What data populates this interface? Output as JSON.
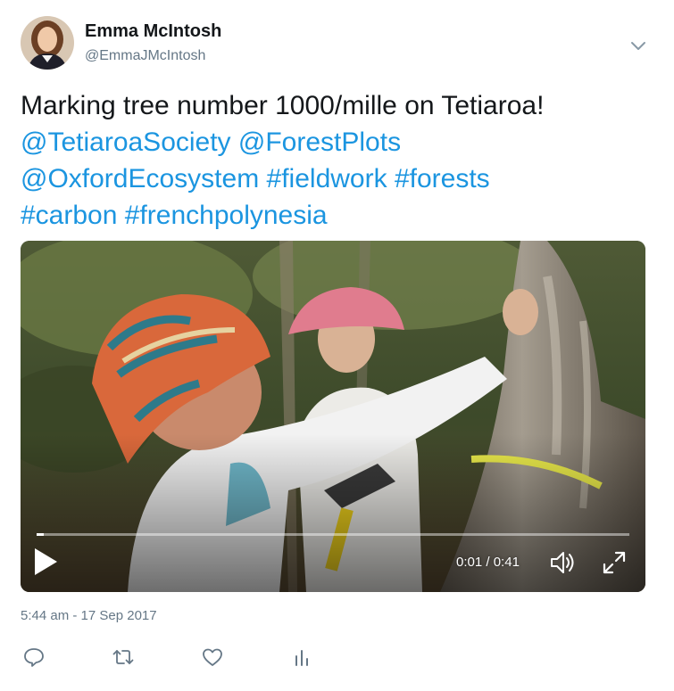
{
  "author": {
    "display_name": "Emma McIntosh",
    "handle": "@EmmaJMcIntosh"
  },
  "tweet": {
    "text_prefix": "Marking tree number 1000/mille on Tetiaroa! ",
    "mentions": [
      "@TetiaroaSociety",
      "@ForestPlots",
      "@OxfordEcosystem"
    ],
    "hashtags": [
      "#fieldwork",
      "#forests",
      "#carbon",
      "#frenchpolynesia"
    ],
    "link_color": "#1b95e0"
  },
  "video": {
    "current_time": "0:01",
    "separator": " / ",
    "duration": "0:41",
    "progress_fraction": 0.012
  },
  "timestamp": "5:44 am - 17 Sep 2017",
  "icons": {
    "caret": "chevron-down-icon",
    "reply": "reply-icon",
    "retweet": "retweet-icon",
    "like": "heart-icon",
    "analytics": "analytics-icon",
    "play": "play-icon",
    "volume": "volume-icon",
    "fullscreen": "fullscreen-icon"
  }
}
